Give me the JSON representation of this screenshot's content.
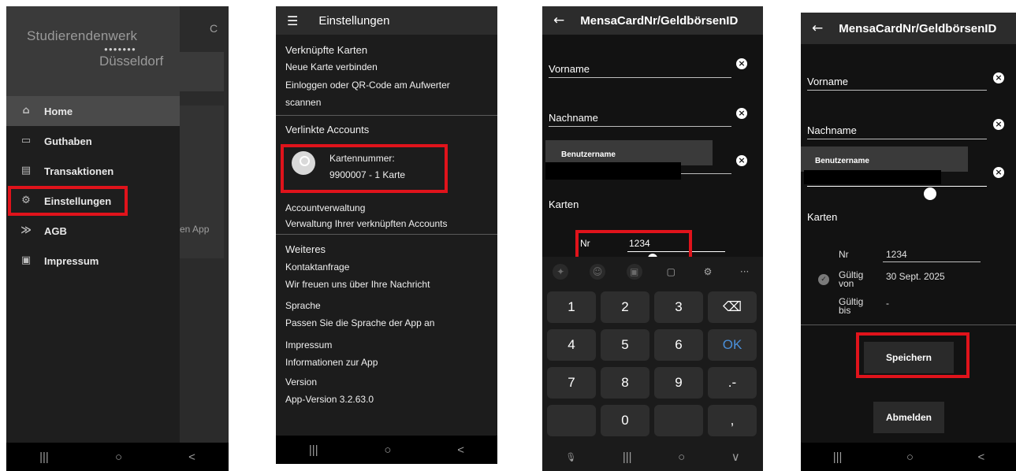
{
  "screen1": {
    "brand_line1": "Studierendenwerk",
    "brand_dots": "●●●●●●●",
    "brand_line2": "Düsseldorf",
    "refresh_icon": "C",
    "background_text": "en App",
    "menu": [
      {
        "label": "Home",
        "icon": "home-icon",
        "glyph": "⌂"
      },
      {
        "label": "Guthaben",
        "icon": "cash-icon",
        "glyph": "▭"
      },
      {
        "label": "Transaktionen",
        "icon": "receipt-icon",
        "glyph": "▤"
      },
      {
        "label": "Einstellungen",
        "icon": "gear-icon",
        "glyph": "⚙"
      },
      {
        "label": "AGB",
        "icon": "handshake-icon",
        "glyph": "≫"
      },
      {
        "label": "Impressum",
        "icon": "clipboard-icon",
        "glyph": "▣"
      }
    ],
    "navbar": {
      "recents": "|||",
      "home": "○",
      "back": "<"
    }
  },
  "screen2": {
    "title": "Einstellungen",
    "menu_icon": "☰",
    "section_linked_cards": "Verknüpfte Karten",
    "connect_card": "Neue Karte verbinden",
    "connect_hint_1": "Einloggen oder QR-Code am Aufwerter",
    "connect_hint_2": "scannen",
    "section_accounts": "Verlinkte Accounts",
    "card_number_label": "Kartennummer:",
    "card_number_value": "9900007 - 1 Karte",
    "account_mgmt": "Accountverwaltung",
    "account_mgmt_desc": "Verwaltung Ihrer verknüpften Accounts",
    "section_more": "Weiteres",
    "contact": "Kontaktanfrage",
    "contact_desc": "Wir freuen uns über Ihre Nachricht",
    "language": "Sprache",
    "language_desc": "Passen Sie die Sprache der App an",
    "imprint": "Impressum",
    "imprint_desc": "Informationen zur App",
    "version": "Version",
    "version_desc": "App-Version 3.2.63.0",
    "navbar": {
      "recents": "|||",
      "home": "○",
      "back": "<"
    }
  },
  "screen3": {
    "title": "MensaCardNr/GeldbörsenID",
    "back_icon": "←",
    "first_name_label": "Vorname",
    "last_name_label": "Nachname",
    "username_tooltip": "Benutzername",
    "cards_label": "Karten",
    "nr_label": "Nr",
    "nr_value": "1234",
    "keys": [
      "1",
      "2",
      "3",
      "⌫",
      "4",
      "5",
      "6",
      "OK",
      "7",
      "8",
      "9",
      ".-",
      "",
      "0",
      "",
      ","
    ],
    "toolbar": [
      "✦",
      "☺",
      "▣",
      "▢",
      "⚙",
      "···"
    ],
    "navbar": {
      "mic": "🎙",
      "recents": "|||",
      "home": "○",
      "down": "∨"
    }
  },
  "screen4": {
    "title": "MensaCardNr/GeldbörsenID",
    "back_icon": "←",
    "first_name_label": "Vorname",
    "last_name_label": "Nachname",
    "username_tooltip": "Benutzername",
    "cards_label": "Karten",
    "nr_label": "Nr",
    "nr_value": "1234",
    "valid_from_label_1": "Gültig",
    "valid_from_label_2": "von",
    "valid_from_value": "30 Sept. 2025",
    "valid_to_label_1": "Gültig",
    "valid_to_label_2": "bis",
    "valid_to_value": "-",
    "save_button": "Speichern",
    "logout_button": "Abmelden",
    "navbar": {
      "recents": "|||",
      "home": "○",
      "back": "<"
    }
  },
  "colors": {
    "highlight": "#e0131b",
    "accent_ok": "#4a8fd9"
  }
}
